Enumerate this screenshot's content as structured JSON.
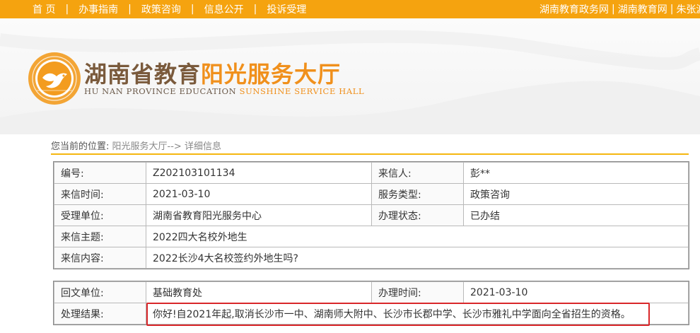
{
  "nav": {
    "items": [
      "首 页",
      "办事指南",
      "政策咨询",
      "信息公开",
      "投诉受理"
    ],
    "right_links": [
      "湖南教育政务网",
      "湖南教育网",
      "朱张渡"
    ]
  },
  "header": {
    "title_part1": "湖南省教育",
    "title_part2": "阳光服务大厅",
    "subtitle_part1": "HU NAN PROVINCE EDUCATION ",
    "subtitle_part2": "SUNSHINE SERVICE HALL"
  },
  "breadcrumb": {
    "prefix": "您当前的位置:",
    "path": "阳光服务大厅--> 详细信息"
  },
  "letter": {
    "number_label": "编号:",
    "number": "Z202103101134",
    "sender_label": "来信人:",
    "sender": "彭**",
    "date_label": "来信时间:",
    "date": "2021-03-10",
    "service_type_label": "服务类型:",
    "service_type": "政策咨询",
    "unit_label": "受理单位:",
    "unit": "湖南省教育阳光服务中心",
    "status_label": "办理状态:",
    "status": "已办结",
    "subject_label": "来信主题:",
    "subject": "2022四大名校外地生",
    "content_label": "来信内容:",
    "content": "2022长沙4大名校签约外地生吗?"
  },
  "reply": {
    "unit_label": "回文单位:",
    "unit": "基础教育处",
    "time_label": "办理时间:",
    "time": "2021-03-10",
    "result_label": "处理结果:",
    "result": "你好!自2021年起,取消长沙市一中、湖南师大附中、长沙市长郡中学、长沙市雅礼中学面向全省招生的资格。"
  },
  "colors": {
    "nav_bg": "#f5a30f",
    "accent_orange": "#f0901c",
    "title_brown": "#7a5a3c",
    "highlight_red": "#d9272a"
  }
}
